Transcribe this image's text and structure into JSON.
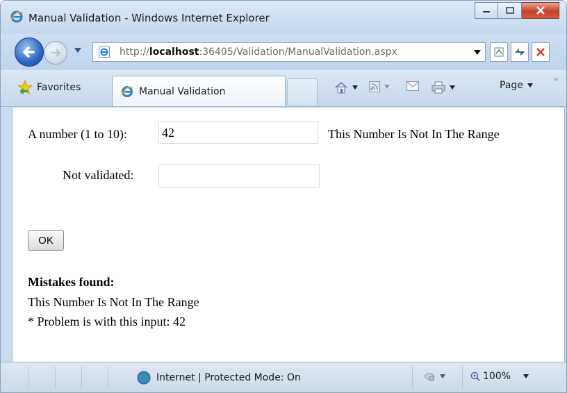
{
  "window": {
    "title": "Manual Validation - Windows Internet Explorer"
  },
  "address_bar": {
    "url_prefix": "http://",
    "url_host": "localhost",
    "url_rest": ":36405/Validation/ManualValidation.aspx"
  },
  "tabs": {
    "favorites_label": "Favorites",
    "active_tab_label": "Manual Validation"
  },
  "command_bar": {
    "page_label": "Page"
  },
  "form": {
    "number_label": "A number (1 to 10):",
    "number_value": "42",
    "number_error": "This Number Is Not In The Range",
    "not_validated_label": "Not validated:",
    "not_validated_value": "",
    "ok_label": "OK"
  },
  "summary": {
    "heading": "Mistakes found:",
    "line1": "This Number Is Not In The Range",
    "line2": "* Problem is with this input: 42"
  },
  "status_bar": {
    "zone_text": "Internet | Protected Mode: On",
    "zoom_text": "100%"
  },
  "colors": {
    "chrome": "#c9dcef",
    "close_button": "#c5432b"
  }
}
